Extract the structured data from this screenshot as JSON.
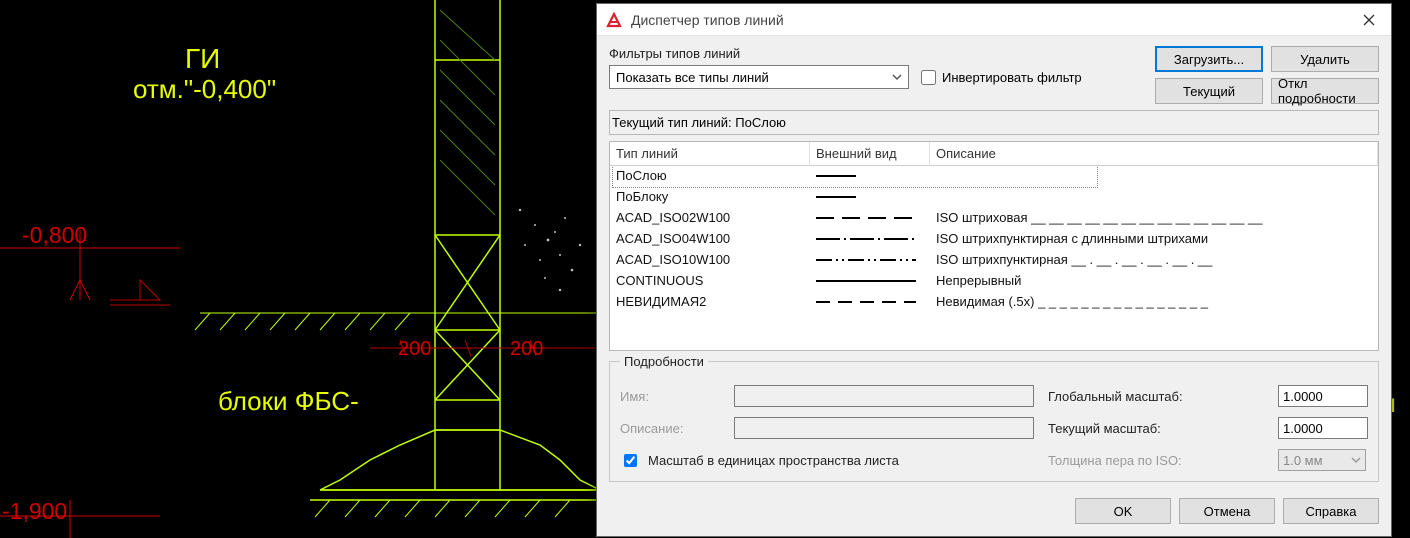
{
  "cad": {
    "label_gi": "ГИ",
    "label_otm": "отм.\"-0,400\"",
    "label_m0800": "-0,800",
    "label_200_l": "200",
    "label_200_r": "200",
    "label_fbs": "блоки ФБС-",
    "label_m1900": "-1,900",
    "label_ki": "ки "
  },
  "dialog": {
    "title": "Диспетчер типов линий",
    "filters_label": "Фильтры типов линий",
    "filter_dropdown": "Показать все типы линий",
    "invert_filter": "Инвертировать фильтр",
    "btn_load": "Загрузить...",
    "btn_delete": "Удалить",
    "btn_current": "Текущий",
    "btn_toggle_details": "Откл подробности",
    "current_line_prefix": "Текущий тип линий:  ",
    "current_line_value": "ПоСлою",
    "col_name": "Тип линий",
    "col_appearance": "Внешний вид",
    "col_description": "Описание",
    "rows": [
      {
        "name": "ПоСлою",
        "desc": "",
        "dash": "40",
        "selected": true
      },
      {
        "name": "ПоБлоку",
        "desc": "",
        "dash": "40",
        "selected": false
      },
      {
        "name": "ACAD_ISO02W100",
        "desc": "ISO штриховая __ __ __ __ __ __ __ __ __ __ __ __ __",
        "dash": "18 8",
        "selected": false
      },
      {
        "name": "ACAD_ISO04W100",
        "desc": "ISO штрихпунктирная с длинными штрихами",
        "dash": "24 4 2 4",
        "selected": false
      },
      {
        "name": "ACAD_ISO10W100",
        "desc": "ISO штрихпунктирная __ . __ . __ . __ . __ . __",
        "dash": "16 4 2 4 2 4",
        "selected": false
      },
      {
        "name": "CONTINUOUS",
        "desc": "Непрерывный",
        "dash": "100",
        "selected": false
      },
      {
        "name": "НЕВИДИМАЯ2",
        "desc": "Невидимая (.5x) _ _ _ _ _ _ _ _ _ _ _ _ _ _ _ _",
        "dash": "14 8",
        "selected": false
      }
    ],
    "details": {
      "legend": "Подробности",
      "name_label": "Имя:",
      "desc_label": "Описание:",
      "global_scale_label": "Глобальный масштаб:",
      "global_scale_value": "1.0000",
      "current_scale_label": "Текущий масштаб:",
      "current_scale_value": "1.0000",
      "iso_pen_label": "Толщина пера по ISO:",
      "iso_pen_value": "1.0 мм",
      "psunits_label": "Масштаб в единицах пространства листа",
      "psunits_checked": true
    },
    "footer": {
      "ok": "OK",
      "cancel": "Отмена",
      "help": "Справка"
    }
  }
}
